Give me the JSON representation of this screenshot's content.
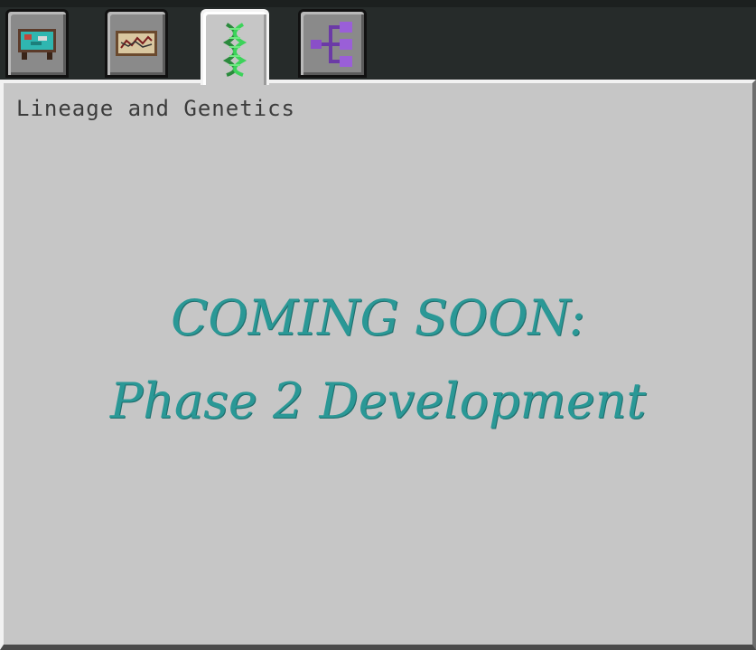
{
  "tabs": [
    {
      "icon": "map-table-icon",
      "active": false
    },
    {
      "icon": "scroll-chart-icon",
      "active": false
    },
    {
      "icon": "dna-helix-icon",
      "active": true
    },
    {
      "icon": "family-tree-icon",
      "active": false
    }
  ],
  "panel": {
    "title": "Lineage and Genetics",
    "message_line1": "COMING SOON:",
    "message_line2": "Phase 2 Development"
  },
  "colors": {
    "panel_bg": "#c6c6c6",
    "message": "#2a9896",
    "dna_green": "#3cd35a",
    "tree_purple": "#8a4fc8"
  }
}
